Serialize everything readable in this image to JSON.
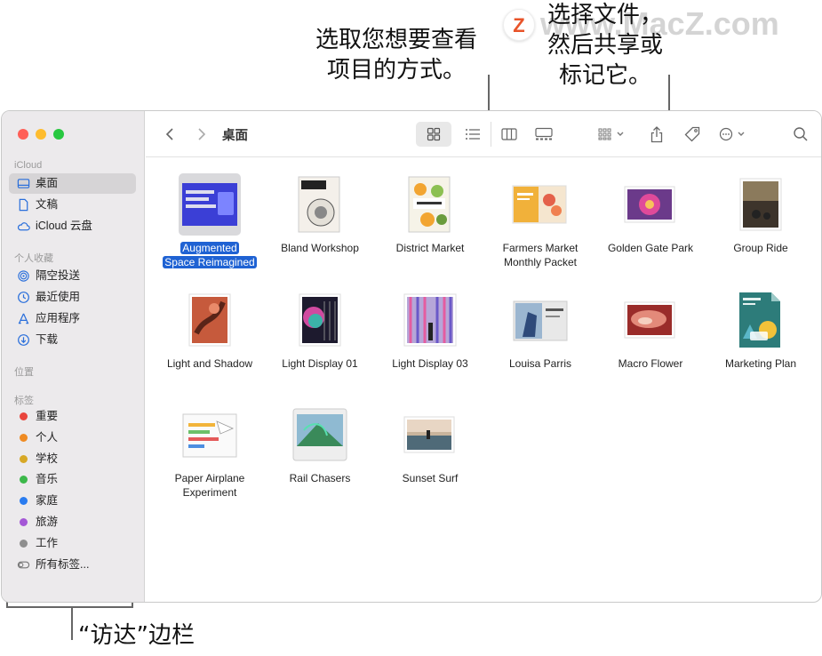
{
  "callouts": {
    "view_line1": "选取您想要查看",
    "view_line2": "项目的方式。",
    "share_line1": "选择文件，",
    "share_line2": "然后共享或",
    "share_line3": "标记它。",
    "sidebar": "“访达”边栏",
    "watermark": "www.MacZ.com",
    "watermark_logo": "Z"
  },
  "window": {
    "traffic_colors": [
      "#ff5f57",
      "#febc2e",
      "#28c840"
    ],
    "toolbar": {
      "title": "桌面"
    },
    "sidebar": {
      "sections": [
        {
          "header": "iCloud",
          "items": [
            {
              "label": "桌面",
              "icon": "desktop-icon",
              "selected": true
            },
            {
              "label": "文稿",
              "icon": "document-icon"
            },
            {
              "label": "iCloud 云盘",
              "icon": "cloud-icon"
            }
          ]
        },
        {
          "header": "个人收藏",
          "items": [
            {
              "label": "隔空投送",
              "icon": "airdrop-icon"
            },
            {
              "label": "最近使用",
              "icon": "clock-icon"
            },
            {
              "label": "应用程序",
              "icon": "apps-icon"
            },
            {
              "label": "下载",
              "icon": "download-icon"
            }
          ]
        },
        {
          "header": "位置",
          "items": []
        },
        {
          "header": "标签",
          "items": [
            {
              "label": "重要",
              "color": "#e9453d"
            },
            {
              "label": "个人",
              "color": "#ef8b23"
            },
            {
              "label": "学校",
              "color": "#d7a826"
            },
            {
              "label": "音乐",
              "color": "#3cb84a"
            },
            {
              "label": "家庭",
              "color": "#2a7cf0"
            },
            {
              "label": "旅游",
              "color": "#a457d6"
            },
            {
              "label": "工作",
              "color": "#8e8e8e"
            },
            {
              "label": "所有标签...",
              "icon": "all-tags-icon"
            }
          ]
        }
      ]
    },
    "files": [
      {
        "name1": "Augmented",
        "name2": "Space Reimagined",
        "selected": true
      },
      {
        "name1": "Bland Workshop"
      },
      {
        "name1": "District Market"
      },
      {
        "name1": "Farmers Market",
        "name2": "Monthly Packet"
      },
      {
        "name1": "Golden Gate Park"
      },
      {
        "name1": "Group Ride"
      },
      {
        "name1": "Light and Shadow"
      },
      {
        "name1": "Light Display 01"
      },
      {
        "name1": "Light Display 03"
      },
      {
        "name1": "Louisa Parris"
      },
      {
        "name1": "Macro Flower"
      },
      {
        "name1": "Marketing Plan"
      },
      {
        "name1": "Paper Airplane",
        "name2": "Experiment"
      },
      {
        "name1": "Rail Chasers"
      },
      {
        "name1": "Sunset Surf"
      }
    ]
  }
}
